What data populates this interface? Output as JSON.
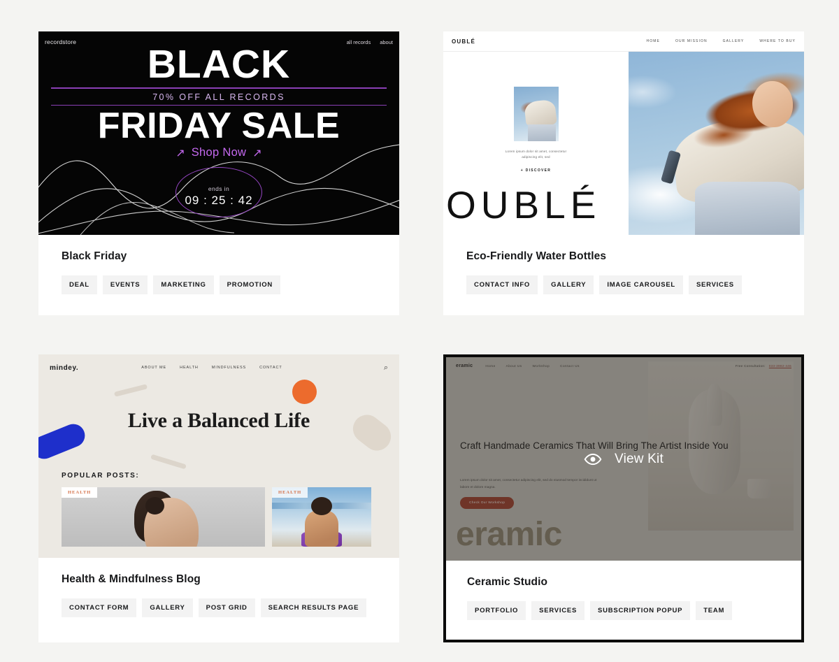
{
  "page": {
    "background_color": "#f4f4f2",
    "card_background": "#ffffff"
  },
  "cards": [
    {
      "title": "Black Friday",
      "tags": [
        "DEAL",
        "EVENTS",
        "MARKETING",
        "PROMOTION"
      ],
      "preview": {
        "kind": "black-friday-record-store",
        "logo": "recordstore",
        "nav": [
          "all records",
          "about"
        ],
        "headline_1": "BLACK",
        "subhead": "70% OFF ALL RECORDS",
        "headline_2": "FRIDAY SALE",
        "cta": "Shop Now",
        "cta_arrow": "↗",
        "timer_label": "ends in",
        "timer_value": "09 : 25 : 42",
        "accent_color": "#c469ef",
        "rule_color": "#8b3fb5",
        "background_color": "#050505"
      }
    },
    {
      "title": "Eco-Friendly Water Bottles",
      "tags": [
        "CONTACT INFO",
        "GALLERY",
        "IMAGE CAROUSEL",
        "SERVICES"
      ],
      "preview": {
        "kind": "ouble-water-bottles",
        "logo": "OUBLÉ",
        "nav": [
          "HOME",
          "OUR MISSION",
          "GALLERY",
          "WHERE TO BUY"
        ],
        "body_text": "Lorem ipsum dolor sit amet, consectetur adipiscing elit, sed",
        "discover_link": "+ DISCOVER",
        "wordmark": "OUBLÉ"
      }
    },
    {
      "title": "Health & Mindfulness Blog",
      "tags": [
        "CONTACT FORM",
        "GALLERY",
        "POST GRID",
        "SEARCH RESULTS PAGE"
      ],
      "preview": {
        "kind": "mindey-blog",
        "logo": "mindey.",
        "nav": [
          "ABOUT ME",
          "HEALTH",
          "MINDFULNESS",
          "CONTACT"
        ],
        "search_icon": "⌕",
        "headline": "Live a Balanced Life",
        "section_label": "POPULAR POSTS:",
        "post_badges": [
          "HEALTH",
          "HEALTH"
        ],
        "background_color": "#ece9e3",
        "accent_orange": "#ec6b2d",
        "accent_blue": "#1e2fcb",
        "accent_beige": "#dfd7cc"
      }
    },
    {
      "title": "Ceramic Studio",
      "tags": [
        "PORTFOLIO",
        "SERVICES",
        "SUBSCRIPTION POPUP",
        "TEAM"
      ],
      "hovered": true,
      "preview": {
        "kind": "ceramic-studio",
        "logo": "eramic",
        "nav": [
          "Home",
          "About Us",
          "Workshop",
          "Contact Us"
        ],
        "phone_label": "Free Consultation:",
        "phone_number": "033-3982-446",
        "headline": "Craft Handmade Ceramics That Will Bring The Artist Inside You",
        "body_text": "Lorem ipsum dolor sit amet, consectetur adipiscing elit, sed do eiusmod tempor incididunt ut labore et dolore magna.",
        "button_label": "Check Our Workshop",
        "wordmark": "eramic",
        "overlay": {
          "icon": "eye-icon",
          "label": "View Kit"
        },
        "button_color": "#9f3f28",
        "border_color": "#0b0b0b"
      }
    }
  ]
}
